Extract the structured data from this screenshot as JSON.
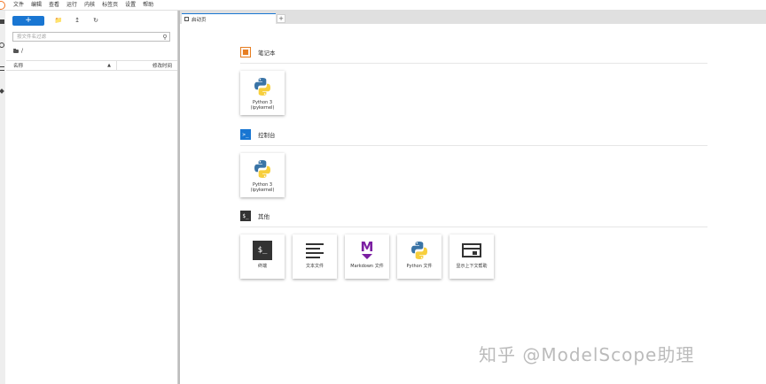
{
  "menubar": {
    "items": [
      "文件",
      "编辑",
      "查看",
      "运行",
      "内核",
      "标签页",
      "设置",
      "帮助"
    ]
  },
  "filebrowser": {
    "new_launcher_label": "+",
    "search_placeholder": "按文件名过滤",
    "breadcrumb": "/",
    "col_name": "名称",
    "col_modified": "修改时间"
  },
  "tabs": {
    "launcher_tab_label": "启动页",
    "add_tab_label": "+"
  },
  "launcher": {
    "sections": [
      {
        "title": "笔记本",
        "icon": "notebook-icon",
        "cards": [
          {
            "label": "Python 3\n(ipykernel)",
            "icon": "python-logo-icon"
          }
        ]
      },
      {
        "title": "控制台",
        "icon": "console-icon",
        "cards": [
          {
            "label": "Python 3\n(ipykernel)",
            "icon": "python-logo-icon"
          }
        ]
      },
      {
        "title": "其他",
        "icon": "terminal-icon",
        "cards": [
          {
            "label": "终端",
            "icon": "terminal-icon"
          },
          {
            "label": "文本文件",
            "icon": "text-file-icon"
          },
          {
            "label": "Markdown 文件",
            "icon": "markdown-icon"
          },
          {
            "label": "Python 文件",
            "icon": "python-logo-icon"
          },
          {
            "label": "显示上下文帮助",
            "icon": "context-help-icon"
          }
        ]
      }
    ],
    "console_icon_text": ">_",
    "other_icon_text": "$_",
    "terminal_glyph_text": "$_",
    "markdown_glyph_text": "M"
  },
  "watermark": "知乎 @ModelScope助理",
  "colors": {
    "accent": "#1976d2",
    "notebook": "#e67e22",
    "markdown": "#7b1fa2",
    "python_blue": "#3a74a6",
    "python_yellow": "#f7cf3d"
  }
}
